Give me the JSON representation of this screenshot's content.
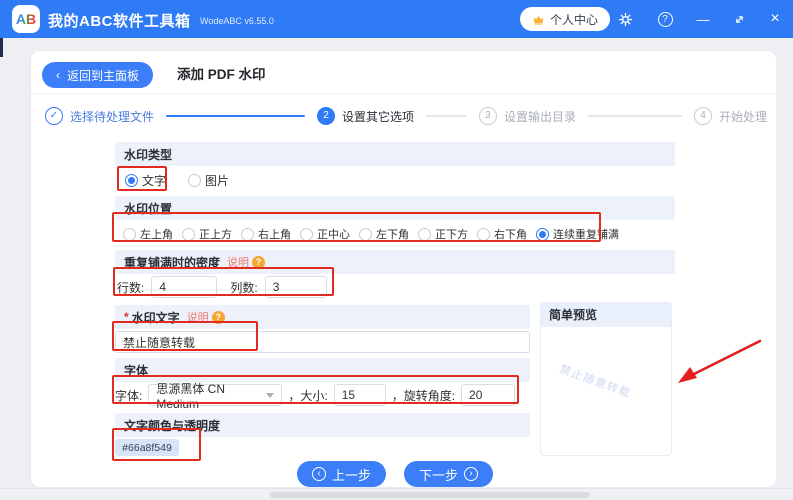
{
  "titlebar": {
    "logo": "AB",
    "app_name": "我的ABC软件工具箱",
    "version": "WodeABC v6.55.0",
    "user_center_label": "个人中心",
    "minimize_glyph": "—",
    "close_glyph": "×",
    "help_glyph": "?"
  },
  "toolbar": {
    "back_chevron": "‹",
    "back_label": "返回到主面板",
    "page_title": "添加 PDF 水印"
  },
  "stepper": {
    "steps": [
      {
        "indicator": "✓",
        "label": "选择待处理文件",
        "state": "done"
      },
      {
        "indicator": "2",
        "label": "设置其它选项",
        "state": "active"
      },
      {
        "indicator": "3",
        "label": "设置输出目录",
        "state": "pending"
      },
      {
        "indicator": "4",
        "label": "开始处理",
        "state": "pending"
      }
    ]
  },
  "form": {
    "type": {
      "header": "水印类型",
      "options": [
        "文字",
        "图片"
      ],
      "selected": "文字"
    },
    "position": {
      "header": "水印位置",
      "options": [
        "左上角",
        "正上方",
        "右上角",
        "正中心",
        "左下角",
        "正下方",
        "右下角",
        "连续重复铺满"
      ],
      "selected": "连续重复铺满"
    },
    "density": {
      "header": "重复铺满时的密度",
      "help": "说明",
      "help_icon": "?",
      "rows_label": "行数:",
      "rows_value": "4",
      "cols_label": "列数:",
      "cols_value": "3"
    },
    "text": {
      "required_mark": "*",
      "header": "水印文字",
      "help": "说明",
      "help_icon": "?",
      "value": "禁止随意转载"
    },
    "font": {
      "header": "字体",
      "family_label": "字体:",
      "family_value": "思源黑体 CN Medium",
      "size_label": "，大小:",
      "size_value": "15",
      "rotate_label": "，旋转角度:",
      "rotate_value": "20"
    },
    "color": {
      "header": "文字颜色与透明度",
      "value": "#66a8f549"
    }
  },
  "preview": {
    "header": "简单预览",
    "watermark": "禁止随意转载"
  },
  "footer": {
    "prev_label": "上一步",
    "next_label": "下一步",
    "prev_icon": "‹",
    "next_icon": "›"
  },
  "colors": {
    "accent": "#2f7bf5",
    "annotation": "#e12b20",
    "section_header_bg": "#edf1f9",
    "watermark_preview_color": "#c9d9f2"
  }
}
